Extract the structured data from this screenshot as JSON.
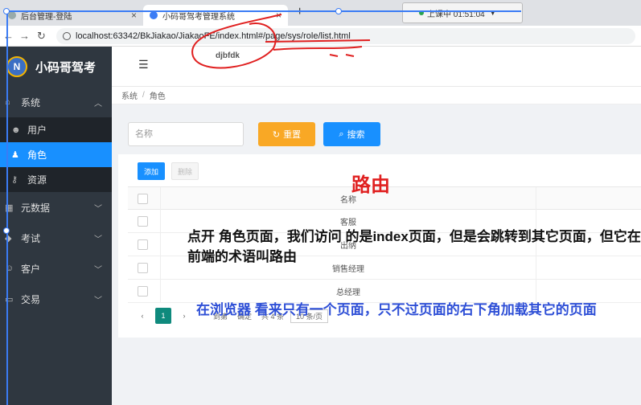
{
  "browser": {
    "tabs": [
      {
        "label": "后台管理-登陆",
        "close": "×"
      },
      {
        "label": "小码哥驾考管理系统",
        "close": "×"
      }
    ],
    "new_tab": "+",
    "meeting": "上课中 01:51:04",
    "url": "localhost:63342/BkJiakao/JiakaoFE/index.html#/page/sys/role/list.html"
  },
  "app": {
    "logo": "小码哥驾考",
    "sidebar": {
      "system": "系统",
      "sub_items": [
        "用户",
        "角色",
        "资源"
      ],
      "groups": [
        "元数据",
        "考试",
        "客户",
        "交易"
      ]
    },
    "breadcrumb": [
      "系统",
      "角色"
    ],
    "search": {
      "name_placeholder": "名称",
      "reset_label": "重置",
      "query_label": "搜索"
    },
    "toolbar": {
      "add_label": "添加",
      "delete_label": "删除"
    },
    "table": {
      "header": "名称",
      "rows": [
        "客服",
        "出纳",
        "销售经理",
        "总经理"
      ]
    },
    "pager": {
      "current_page": "1",
      "goto_label": "到第",
      "confirm_label": "确定",
      "total_label": "共 4 条",
      "page_size": "10 条/页"
    }
  },
  "annotations": {
    "title": "路由",
    "main_text": "点开 角色页面，我们访问 的是index页面，但是会跳转到其它页面，但它在前端的术语叫路由",
    "blue_text": "在浏览器 看来只有一个页面，只不过页面的右下角加载其它的页面",
    "signature": "djbfdk"
  }
}
